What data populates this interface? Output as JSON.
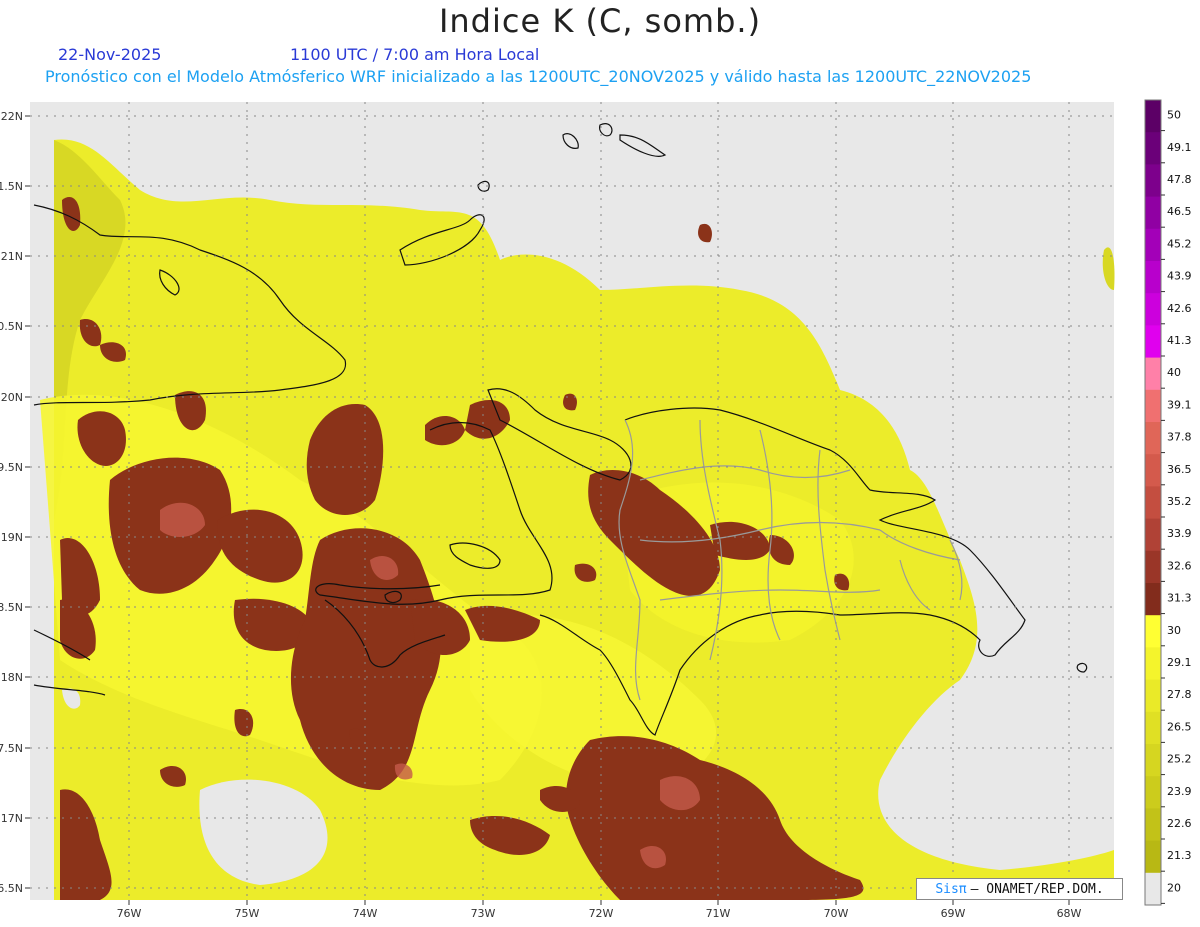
{
  "header": {
    "title": "Indice K (C, somb.)",
    "date": "22-Nov-2025",
    "valid_time": "1100 UTC / 7:00 am Hora Local",
    "description": "Pronóstico con el Modelo Atmósferico WRF inicializado a las 1200UTC_20NOV2025 y válido hasta las  1200UTC_22NOV2025"
  },
  "axes": {
    "lon_labels": [
      "76W",
      "75W",
      "74W",
      "73W",
      "72W",
      "71W",
      "70W",
      "69W",
      "68W"
    ],
    "lat_labels": [
      "22N",
      "1.5N",
      "21N",
      "0.5N",
      "20N",
      "9.5N",
      "19N",
      "8.5N",
      "18N",
      "7.5N",
      "17N",
      "6.5N"
    ]
  },
  "colorbar": {
    "labels": [
      "50",
      "49.1",
      "47.8",
      "46.5",
      "45.2",
      "43.9",
      "42.6",
      "41.3",
      "40",
      "39.1",
      "37.8",
      "36.5",
      "35.2",
      "33.9",
      "32.6",
      "31.3",
      "30",
      "29.1",
      "27.8",
      "26.5",
      "25.2",
      "23.9",
      "22.6",
      "21.3",
      "20"
    ],
    "colors": [
      "#5c0066",
      "#6b0079",
      "#7d008c",
      "#9000a3",
      "#a300b8",
      "#b800cc",
      "#cc00dd",
      "#e000ee",
      "#ff80a8",
      "#f07070",
      "#e06658",
      "#d45a4c",
      "#c44e40",
      "#b04236",
      "#9a3628",
      "#822c1c",
      "#ffff33",
      "#f4f42c",
      "#eaea28",
      "#e0e024",
      "#d6d620",
      "#cccc1c",
      "#c2c218",
      "#b8b814",
      "#e8e8e8"
    ]
  },
  "credit": {
    "brand": "Sisπ",
    "text": "– ONAMET/REP.DOM."
  }
}
